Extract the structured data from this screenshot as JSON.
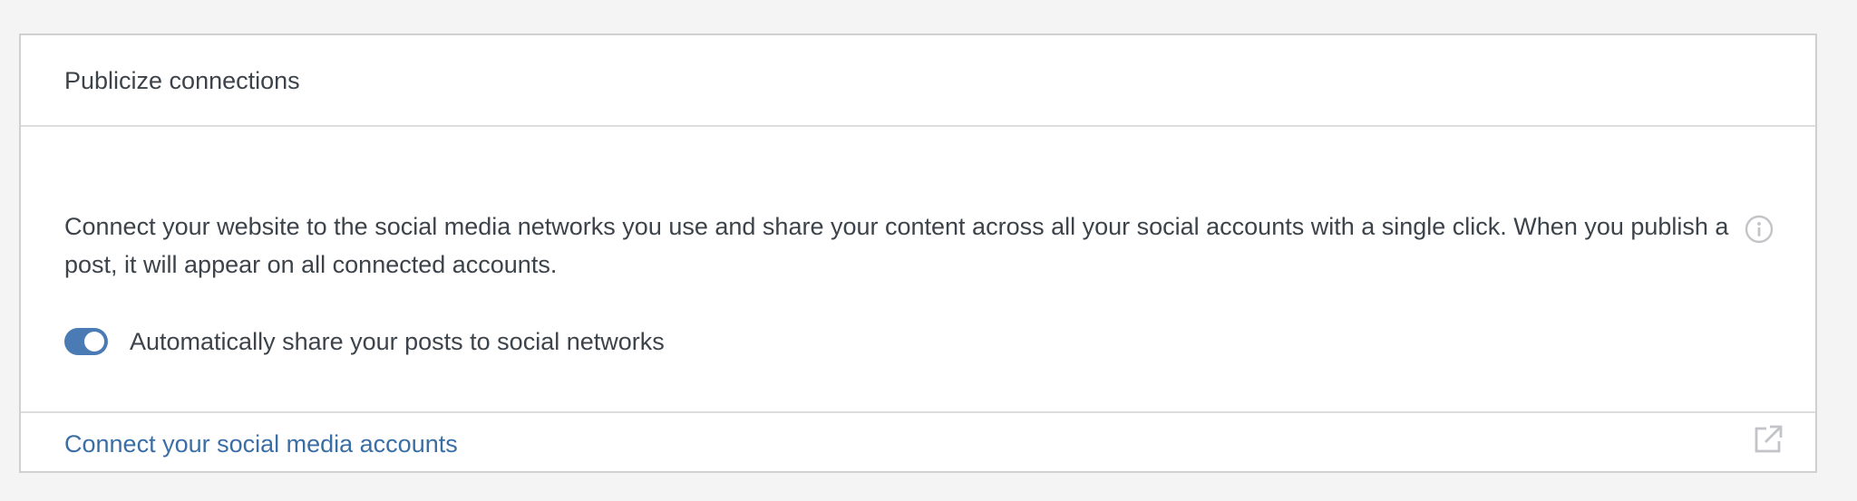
{
  "card": {
    "title": "Publicize connections",
    "description": "Connect your website to the social media networks you use and share your content across all your social accounts with a single click. When you publish a post, it will appear on all connected accounts.",
    "toggle": {
      "label": "Automatically share your posts to social networks",
      "enabled": true
    },
    "footer_link": "Connect your social media accounts"
  },
  "icons": {
    "info": "info-icon",
    "external": "external-link-icon"
  },
  "colors": {
    "accent": "#4a7bb5",
    "link": "#3a6ea5",
    "text": "#3c434a",
    "border": "#dcdcde",
    "background": "#f4f4f4"
  }
}
